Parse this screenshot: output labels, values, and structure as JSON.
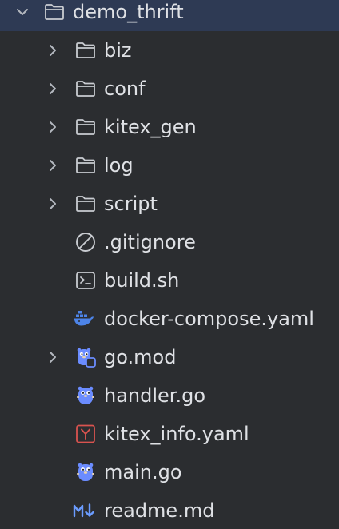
{
  "project_tree": {
    "root": {
      "label": "demo_thrift",
      "expanded": true,
      "icon": "folder-icon"
    },
    "items": [
      {
        "label": "biz",
        "icon": "folder-icon",
        "collapsible": true
      },
      {
        "label": "conf",
        "icon": "folder-icon",
        "collapsible": true
      },
      {
        "label": "kitex_gen",
        "icon": "folder-icon",
        "collapsible": true
      },
      {
        "label": "log",
        "icon": "folder-icon",
        "collapsible": true
      },
      {
        "label": "script",
        "icon": "folder-icon",
        "collapsible": true
      },
      {
        "label": ".gitignore",
        "icon": "ignore-file-icon",
        "collapsible": false
      },
      {
        "label": "build.sh",
        "icon": "shell-script-icon",
        "collapsible": false
      },
      {
        "label": "docker-compose.yaml",
        "icon": "docker-icon",
        "collapsible": false
      },
      {
        "label": "go.mod",
        "icon": "go-module-icon",
        "collapsible": true
      },
      {
        "label": "handler.go",
        "icon": "go-gopher-icon",
        "collapsible": false
      },
      {
        "label": "kitex_info.yaml",
        "icon": "yaml-icon",
        "collapsible": false
      },
      {
        "label": "main.go",
        "icon": "go-gopher-icon",
        "collapsible": false
      },
      {
        "label": "readme.md",
        "icon": "markdown-icon",
        "collapsible": false
      }
    ]
  },
  "colors": {
    "background": "#2b2d30",
    "selection": "#2e3a54",
    "text": "#dfe1e5",
    "chevron": "#b4b8bf",
    "folder_outline": "#c9ccd1",
    "gopher": "#6b8cff",
    "docker": "#4d84e8",
    "yaml": "#d9534f"
  }
}
